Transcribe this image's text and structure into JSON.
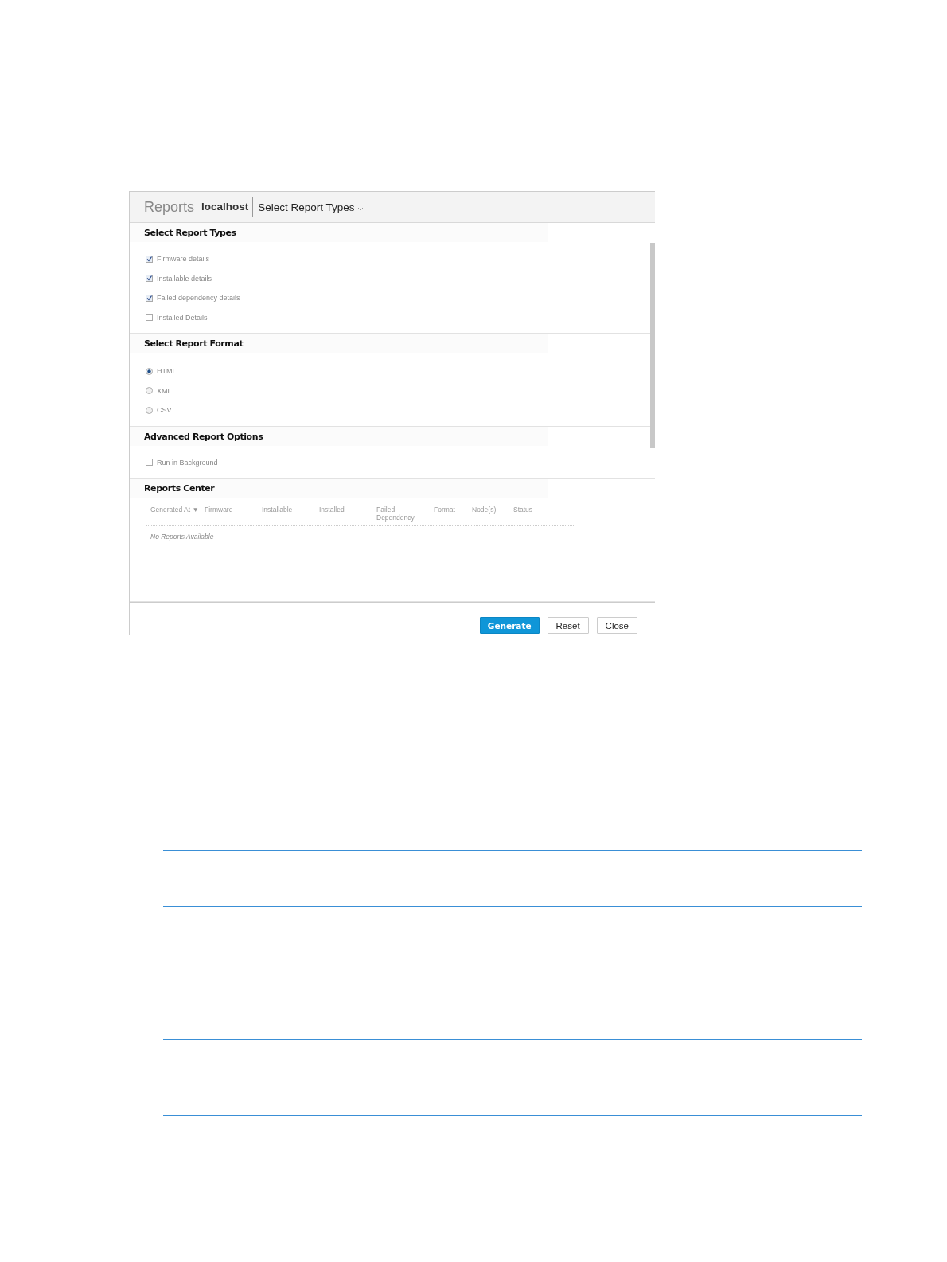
{
  "header": {
    "title": "Reports",
    "host": "localhost",
    "menu": "Select Report Types"
  },
  "sections": [
    {
      "kind": "checklist",
      "title": "Select Report Types",
      "items": [
        {
          "label": "Firmware details",
          "checked": true
        },
        {
          "label": "Installable details",
          "checked": true
        },
        {
          "label": "Failed dependency details",
          "checked": true
        },
        {
          "label": "Installed Details",
          "checked": false
        }
      ]
    },
    {
      "kind": "radios",
      "title": "Select Report Format",
      "items": [
        {
          "label": "HTML",
          "selected": true
        },
        {
          "label": "XML",
          "selected": false
        },
        {
          "label": "CSV",
          "selected": false
        }
      ]
    },
    {
      "kind": "checklist",
      "title": "Advanced Report Options",
      "items": [
        {
          "label": "Run in Background",
          "checked": false
        }
      ]
    },
    {
      "kind": "table",
      "title": "Reports Center",
      "columns": [
        {
          "label": "Generated At",
          "sort_mark": "▼"
        },
        {
          "label": "Firmware"
        },
        {
          "label": "Installable"
        },
        {
          "label": "Installed"
        },
        {
          "label": "Failed Dependency"
        },
        {
          "label": "Format"
        },
        {
          "label": "Node(s)"
        },
        {
          "label": "Status"
        }
      ],
      "empty_message": "No Reports Available"
    }
  ],
  "buttons": [
    {
      "label": "Generate",
      "kind": "primary"
    },
    {
      "label": "Reset",
      "kind": "plain"
    },
    {
      "label": "Close",
      "kind": "plain"
    }
  ]
}
